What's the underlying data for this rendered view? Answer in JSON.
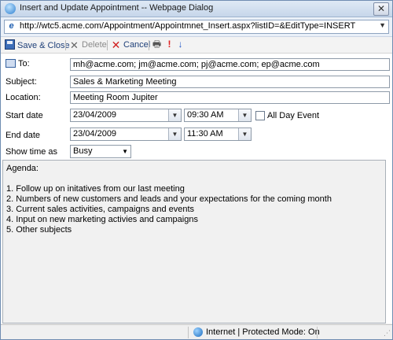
{
  "window": {
    "title": "Insert and Update Appointment -- Webpage Dialog",
    "close_glyph": "✕",
    "url": "http://wtc5.acme.com/Appointment/Appointmnet_Insert.aspx?listID=&EditType=INSERT"
  },
  "toolbar": {
    "save_close": "Save & Close",
    "delete": "Delete",
    "cancel": "Cancel",
    "icons": [
      "printer-icon",
      "importance-high-icon",
      "importance-low-icon"
    ]
  },
  "form": {
    "to_label": "To:",
    "to_value": "mh@acme.com; jm@acme.com; pj@acme.com; ep@acme.com",
    "subject_label": "Subject:",
    "subject_value": "Sales & Marketing Meeting",
    "location_label": "Location:",
    "location_value": "Meeting Room Jupiter",
    "start_label": "Start date",
    "start_date": "23/04/2009",
    "start_time": "09:30 AM",
    "all_day_label": "All Day Event",
    "all_day_checked": false,
    "end_label": "End date",
    "end_date": "23/04/2009",
    "end_time": "11:30 AM",
    "show_time_label": "Show time as",
    "show_time_value": "Busy",
    "agenda_lines": [
      "Agenda:",
      "",
      "1.   Follow up on initatives from our last meeting",
      "2.   Numbers of new customers and leads and your expectations for the coming month",
      "3.   Current sales activities, campaigns and events",
      "4.   Input on new marketing activies and campaigns",
      "5.   Other subjects"
    ]
  },
  "status": {
    "zone": "Internet | Protected Mode: On"
  },
  "colors": {
    "toolbar_text": "#1e3f78",
    "cancel_red": "#d02020",
    "agenda_bg": "#f1f1f1"
  }
}
